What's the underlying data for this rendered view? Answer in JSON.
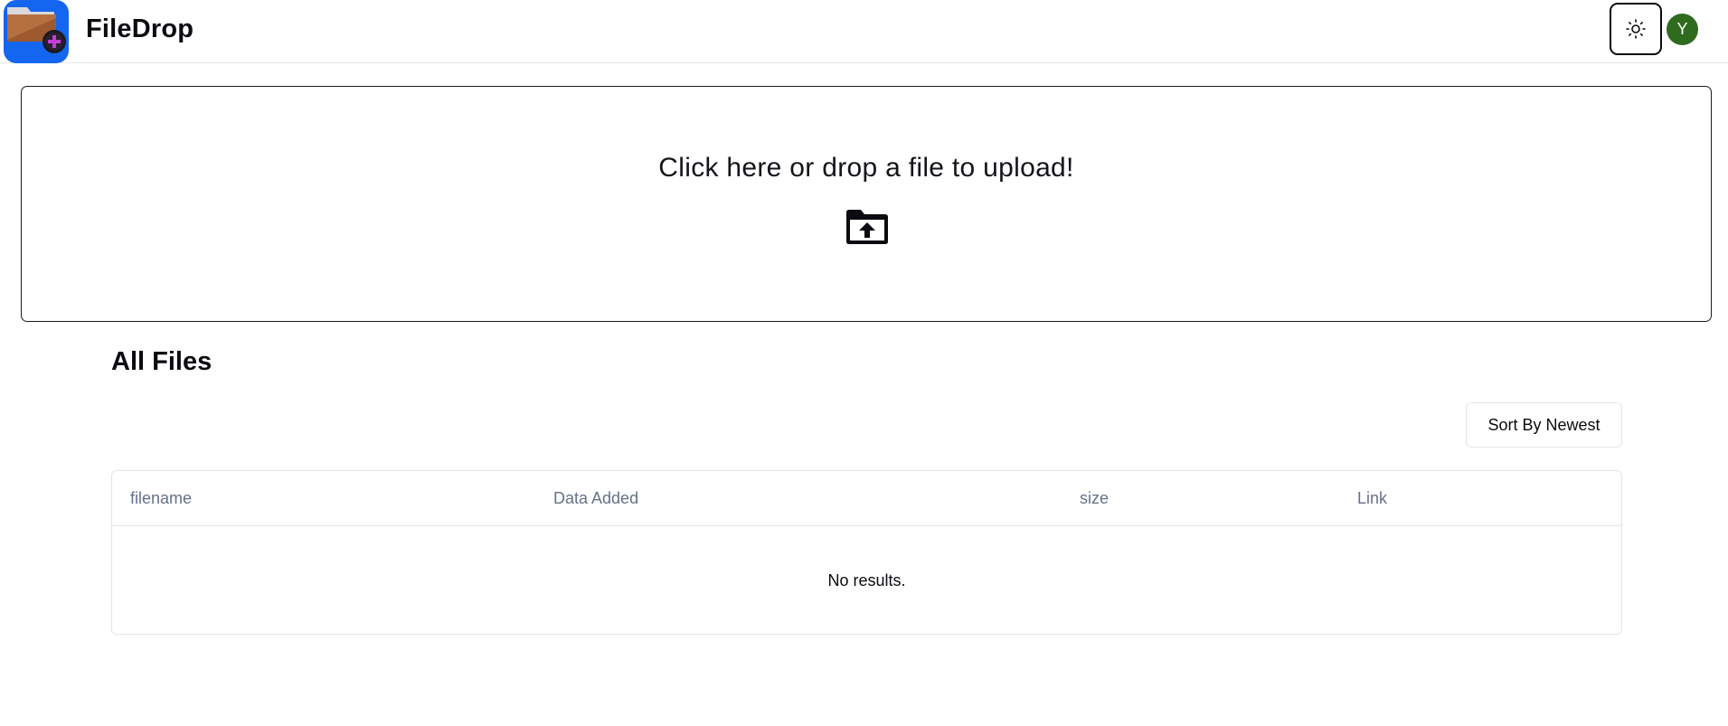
{
  "header": {
    "app_title": "FileDrop",
    "logo_icon": "folder-plus-icon",
    "theme_icon": "sun-icon",
    "avatar_initial": "Y",
    "colors": {
      "logo_bg": "#1466f0",
      "avatar_bg": "#2f6b1f"
    }
  },
  "upload": {
    "prompt": "Click here or drop a file to upload!",
    "icon": "folder-upload-icon"
  },
  "files": {
    "title": "All Files",
    "sort_label": "Sort By Newest",
    "columns": [
      "filename",
      "Data Added",
      "size",
      "Link"
    ],
    "empty_message": "No results."
  }
}
